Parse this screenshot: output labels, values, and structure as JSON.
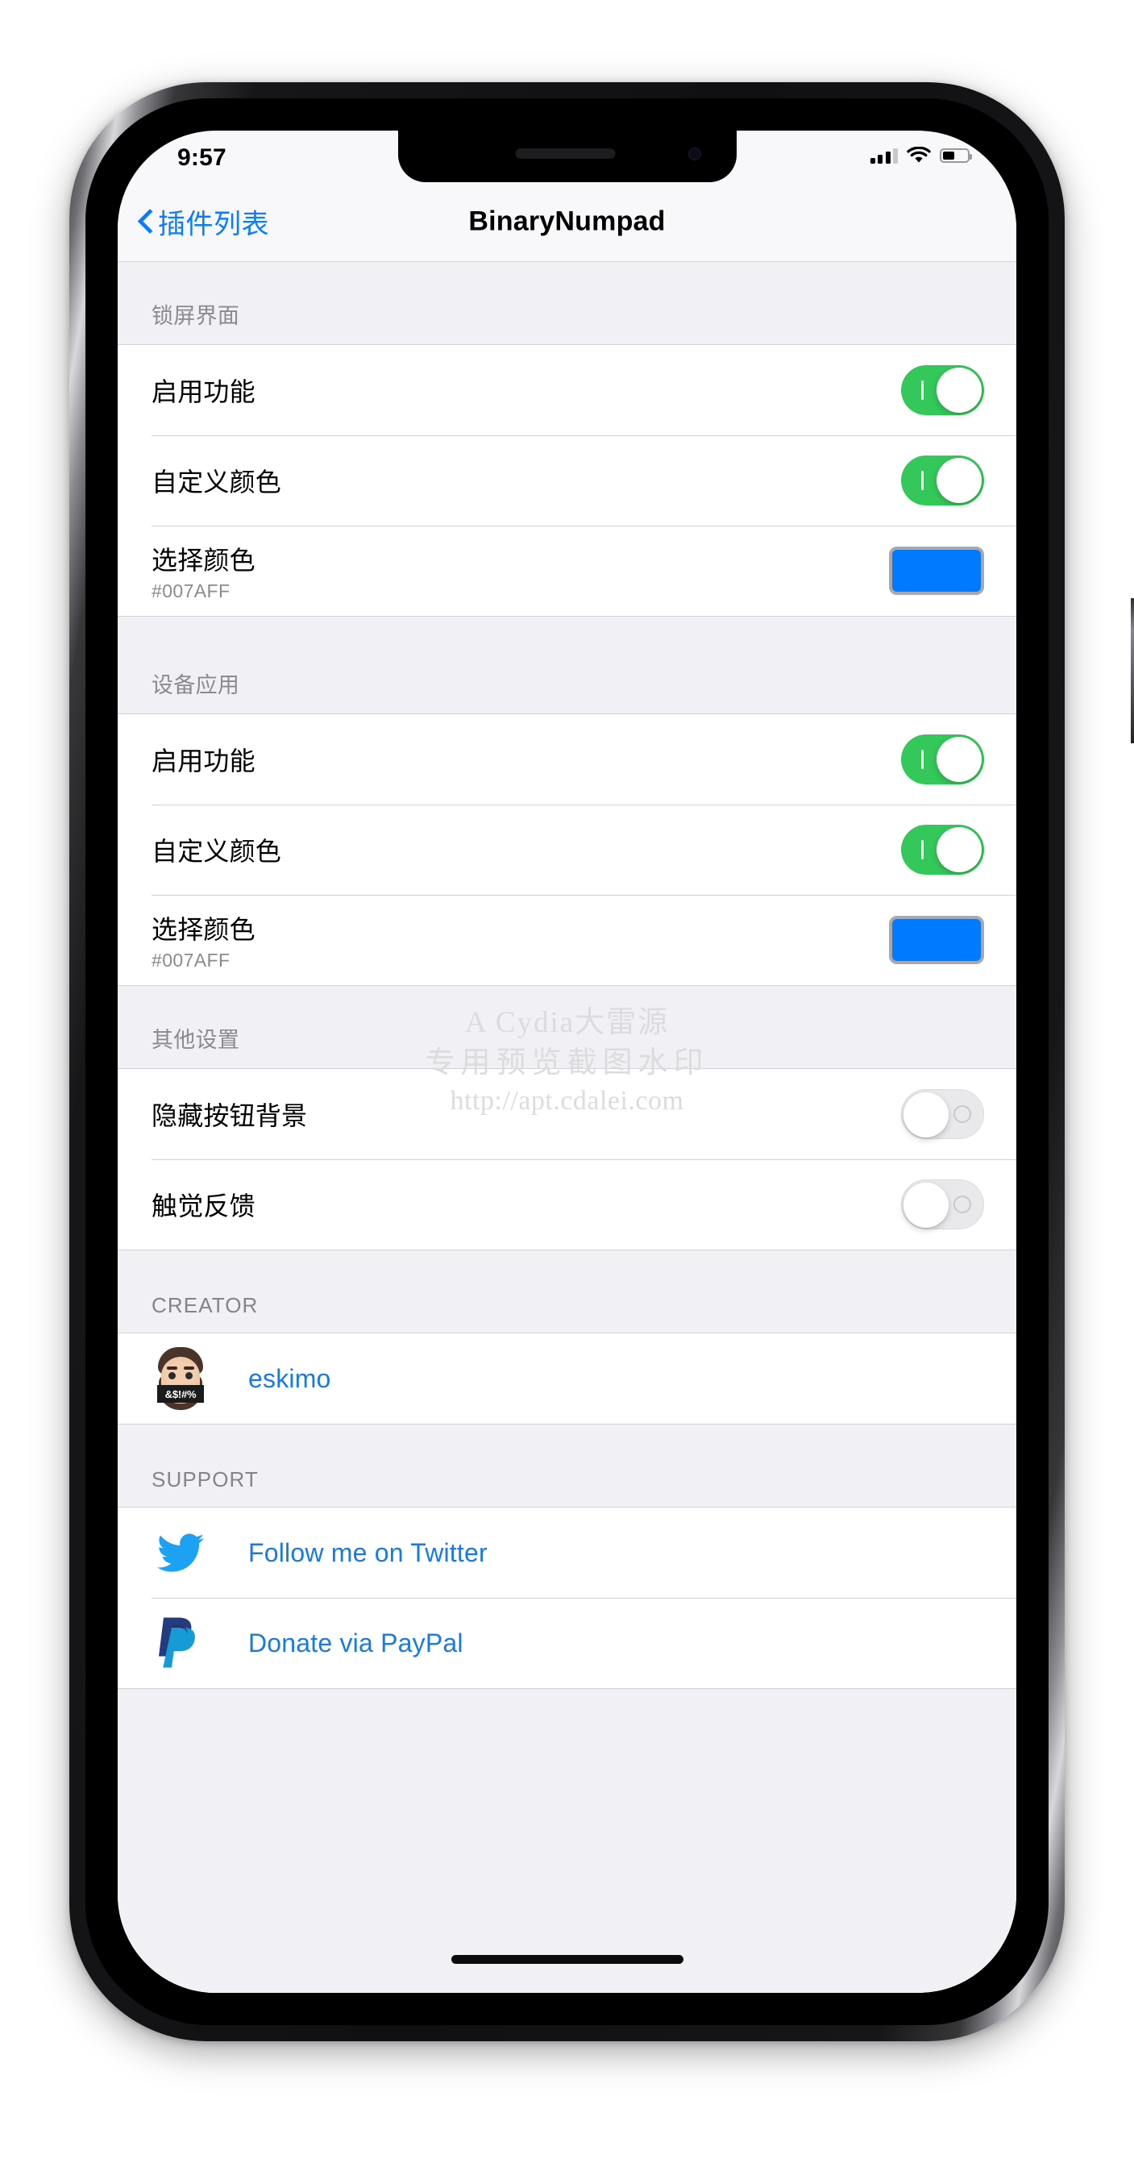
{
  "status_bar": {
    "time": "9:57",
    "signal_icon": "cellular-signal-icon",
    "signal_bars_filled": 3,
    "signal_bars_total": 4,
    "wifi_icon": "wifi-icon",
    "battery_icon": "battery-icon",
    "battery_percent": 42
  },
  "nav": {
    "back_label": "插件列表",
    "back_icon": "chevron-left-icon",
    "title": "BinaryNumpad"
  },
  "watermark": {
    "line1": "A Cydia大雷源",
    "line2": "专用预览截图水印",
    "line3": "http://apt.cdalei.com"
  },
  "sections": [
    {
      "header": "锁屏界面",
      "rows": [
        {
          "title": "启用功能",
          "control": "switch",
          "state": "on"
        },
        {
          "title": "自定义颜色",
          "control": "switch",
          "state": "on"
        },
        {
          "title": "选择颜色",
          "subtitle": "#007AFF",
          "control": "color",
          "color": "#007AFF"
        }
      ]
    },
    {
      "header": "设备应用",
      "rows": [
        {
          "title": "启用功能",
          "control": "switch",
          "state": "on"
        },
        {
          "title": "自定义颜色",
          "control": "switch",
          "state": "on"
        },
        {
          "title": "选择颜色",
          "subtitle": "#007AFF",
          "control": "color",
          "color": "#007AFF"
        }
      ]
    },
    {
      "header": "其他设置",
      "rows": [
        {
          "title": "隐藏按钮背景",
          "control": "switch",
          "state": "off"
        },
        {
          "title": "触觉反馈",
          "control": "switch",
          "state": "off"
        }
      ]
    },
    {
      "header": "CREATOR",
      "rows": [
        {
          "link": "eskimo",
          "icon": "memoji-avatar-icon",
          "censor_text": "&$!#%"
        }
      ]
    },
    {
      "header": "SUPPORT",
      "rows": [
        {
          "link": "Follow me on Twitter",
          "icon": "twitter-bird-icon"
        },
        {
          "link": "Donate via PayPal",
          "icon": "paypal-icon"
        }
      ]
    }
  ],
  "colors": {
    "accent_blue": "#007AFF",
    "link_blue": "#1A7AE0",
    "switch_on_green": "#34C759",
    "twitter_blue": "#1DA1F2",
    "paypal_dark": "#253B80",
    "paypal_light": "#179BD7",
    "group_background": "#F0F0F5"
  }
}
